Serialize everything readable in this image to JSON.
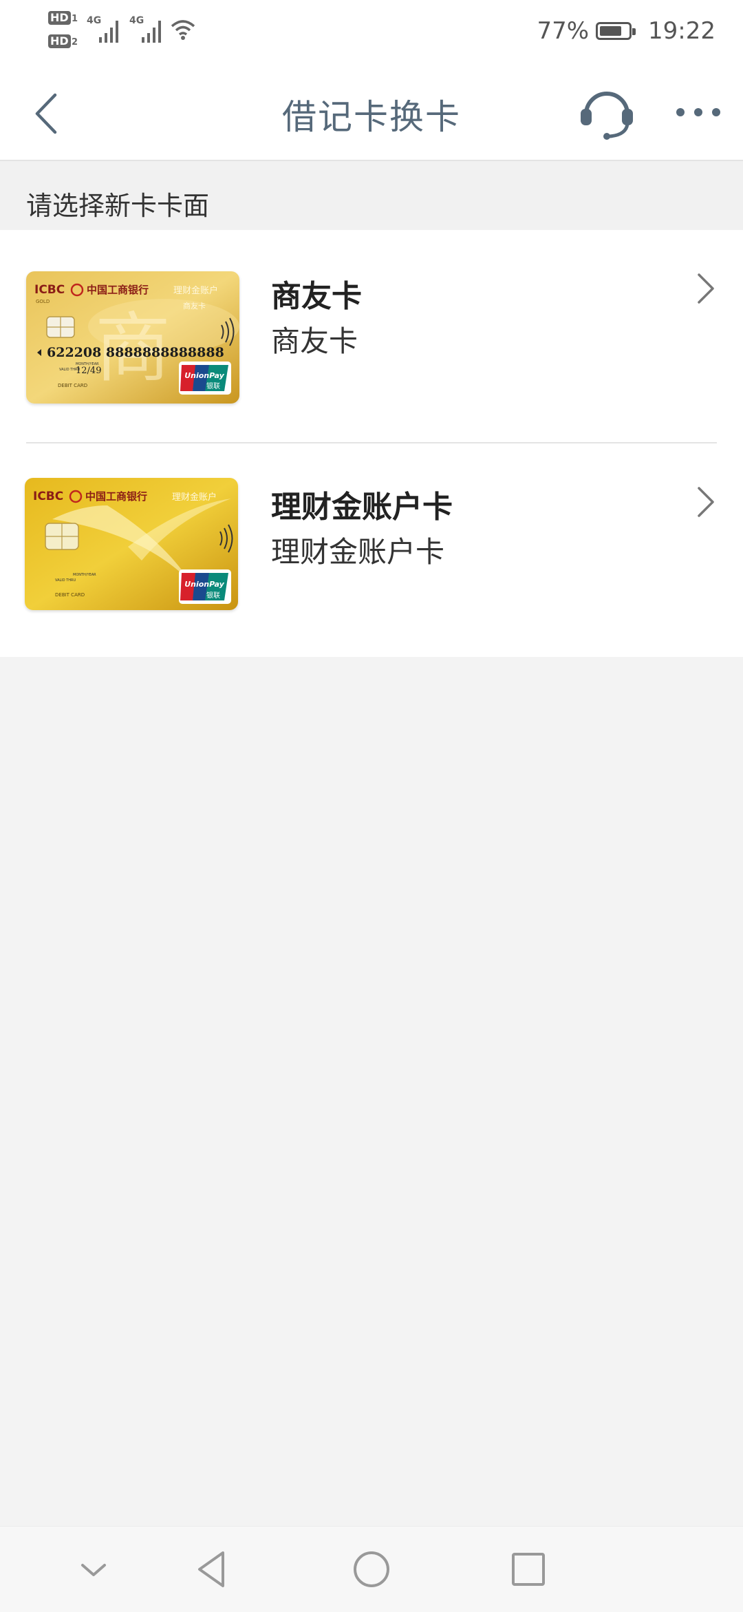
{
  "status_bar": {
    "hd1": "HD",
    "hd1_sub": "1",
    "hd2": "HD",
    "hd2_sub": "2",
    "network1": "4G",
    "network2": "4G",
    "battery_percent": "77%",
    "battery_level": 0.77,
    "time": "19:22"
  },
  "header": {
    "title": "借记卡换卡",
    "back_icon": "chevron-left",
    "service_icon": "headset",
    "more_icon": "ellipsis"
  },
  "section": {
    "label": "请选择新卡卡面"
  },
  "cards": [
    {
      "title": "商友卡",
      "subtitle": "商友卡",
      "image": {
        "bank_code": "ICBC",
        "bank_name": "中国工商银行",
        "tier": "GOLD",
        "product": "理财金账户",
        "sub_product": "商友卡",
        "number": "622208 8888888888888",
        "valid_label": "MONTH/YEAR",
        "valid_thru": "VALID THRU",
        "expiry": "12/49",
        "card_type": "DEBIT CARD",
        "network": "UnionPay",
        "network_cn": "银联",
        "watermark": "商"
      }
    },
    {
      "title": "理财金账户卡",
      "subtitle": "理财金账户卡",
      "image": {
        "bank_code": "ICBC",
        "bank_name": "中国工商银行",
        "product": "理财金账户",
        "valid_label": "MONTH/YEAR",
        "valid_thru": "VALID THRU",
        "card_type": "DEBIT CARD",
        "network": "UnionPay",
        "network_cn": "银联"
      }
    }
  ],
  "nav_bar": {
    "items": [
      "collapse-icon",
      "back-triangle-icon",
      "home-circle-icon",
      "recents-square-icon"
    ]
  }
}
